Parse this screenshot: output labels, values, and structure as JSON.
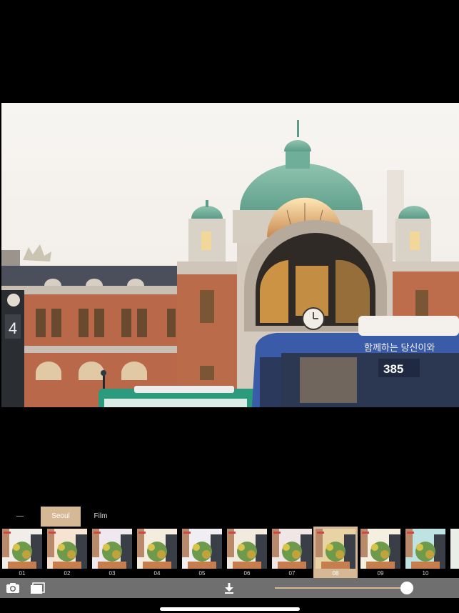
{
  "photo": {
    "subject": "Old Seoul Station building with green domes and blue city bus",
    "bus_number": "385",
    "bus_sign_text": "함께하는 당신이와",
    "stop_number": "4"
  },
  "filter_tabs": [
    {
      "label": "—"
    },
    {
      "label": "Seoul"
    },
    {
      "label": "Film"
    }
  ],
  "selected_tab": "Seoul",
  "thumbnails": [
    {
      "label": "01"
    },
    {
      "label": "02"
    },
    {
      "label": "03"
    },
    {
      "label": "04"
    },
    {
      "label": "05"
    },
    {
      "label": "06"
    },
    {
      "label": "07"
    },
    {
      "label": "08"
    },
    {
      "label": "09"
    },
    {
      "label": "10"
    }
  ],
  "selected_thumbnail": "08",
  "toolbar": {
    "camera_icon": "camera-icon",
    "gallery_icon": "photo-library-icon",
    "download_icon": "download-icon",
    "intensity": 0.95
  },
  "colors": {
    "accent": "#d6b895",
    "toolbar": "#6f6f6f",
    "background": "#000000"
  }
}
